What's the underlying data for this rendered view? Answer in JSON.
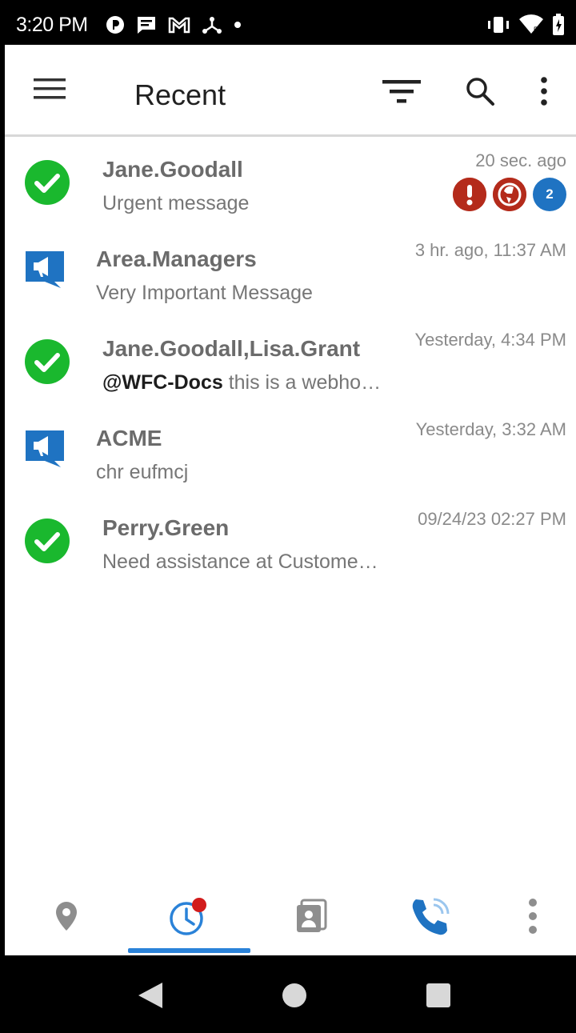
{
  "status_bar": {
    "time": "3:20 PM",
    "left_icons": [
      "app-icon",
      "message-icon",
      "gmail-icon",
      "network-icon",
      "dot-icon"
    ],
    "right_icons": [
      "vibrate-icon",
      "wifi-icon",
      "battery-icon"
    ]
  },
  "app_bar": {
    "title": "Recent"
  },
  "conversations": [
    {
      "name": "Jane.Goodall",
      "message": "Urgent message",
      "time": "20 sec. ago",
      "avatar": "check-circle-icon",
      "badges": [
        "urgent-icon",
        "priority-icon"
      ],
      "unread_count": "2"
    },
    {
      "name": "Area.Managers",
      "message": "Very Important Message",
      "time": "3 hr. ago, 11:37 AM",
      "avatar": "broadcast-icon"
    },
    {
      "name": "Jane.Goodall,Lisa.Grant",
      "mention": "@WFC-Docs",
      "message": " this is a webho…",
      "time": "Yesterday, 4:34 PM",
      "avatar": "check-circle-icon"
    },
    {
      "name": "ACME",
      "message": "chr eufmcj",
      "time": "Yesterday, 3:32 AM",
      "avatar": "broadcast-icon"
    },
    {
      "name": "Perry.Green",
      "message": "Need assistance at Custome…",
      "time": "09/24/23 02:27 PM",
      "avatar": "check-circle-icon"
    }
  ],
  "bottom_nav": {
    "items": [
      "location-icon",
      "recent-icon",
      "contacts-icon",
      "calls-icon",
      "more-vert-icon"
    ],
    "selected": "recent-icon"
  },
  "colors": {
    "check_green": "#1ab82e",
    "broadcast_blue": "#1f73c2",
    "urgent_red": "#b42b1b",
    "accent_blue": "#2a82d8"
  }
}
